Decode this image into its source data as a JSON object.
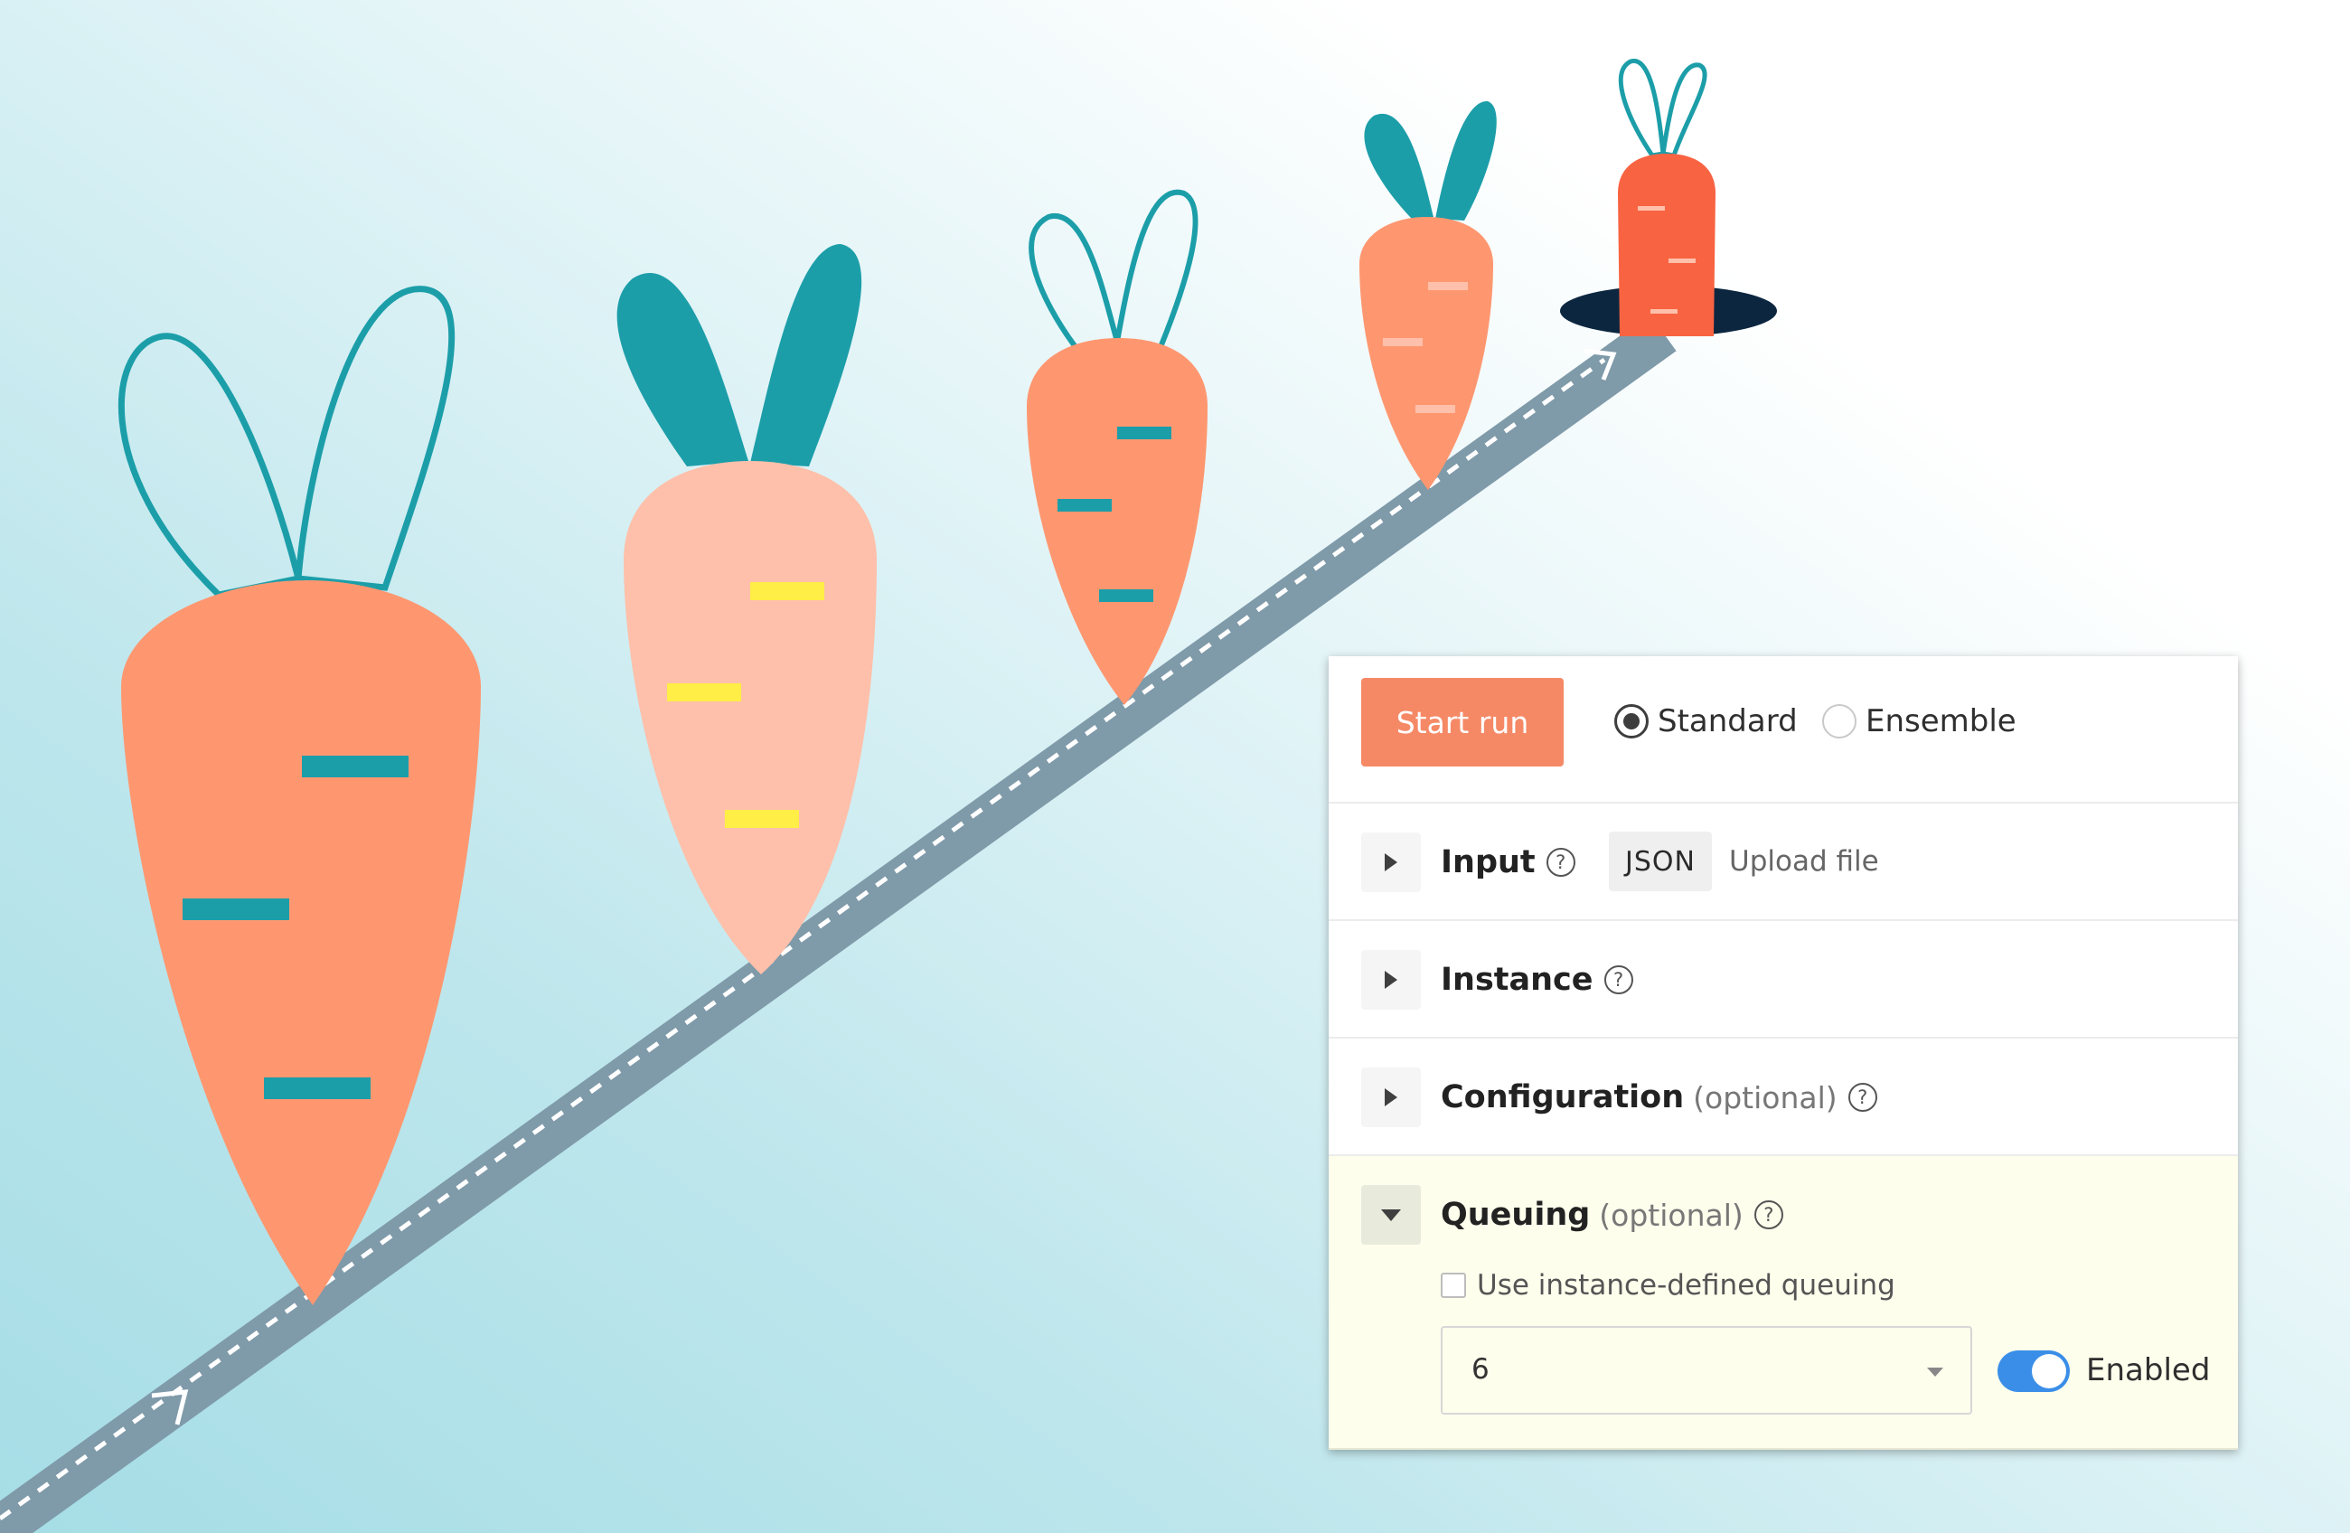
{
  "colors": {
    "carrot_orange": "#fe9770",
    "carrot_pale": "#fec0aa",
    "carrot_red": "#f86342",
    "teal": "#1c9ea9",
    "yellow": "#ffee45",
    "track": "#7f9aa9",
    "hole": "#0c2640",
    "button": "#f58966",
    "toggle_on": "#3a8ee8"
  },
  "toolbar": {
    "start_run_label": "Start run",
    "mode_options": [
      {
        "label": "Standard",
        "selected": true
      },
      {
        "label": "Ensemble",
        "selected": false
      }
    ]
  },
  "sections": {
    "input": {
      "title": "Input",
      "help": "?",
      "chip": "JSON",
      "upload_label": "Upload file",
      "expanded": false
    },
    "instance": {
      "title": "Instance",
      "help": "?",
      "expanded": false
    },
    "configuration": {
      "title": "Configuration",
      "optional_label": "(optional)",
      "help": "?",
      "expanded": false
    },
    "queuing": {
      "title": "Queuing",
      "optional_label": "(optional)",
      "help": "?",
      "expanded": true,
      "checkbox_label": "Use instance-defined queuing",
      "checkbox_checked": false,
      "select_value": "6",
      "toggle_label": "Enabled",
      "toggle_on": true
    }
  }
}
